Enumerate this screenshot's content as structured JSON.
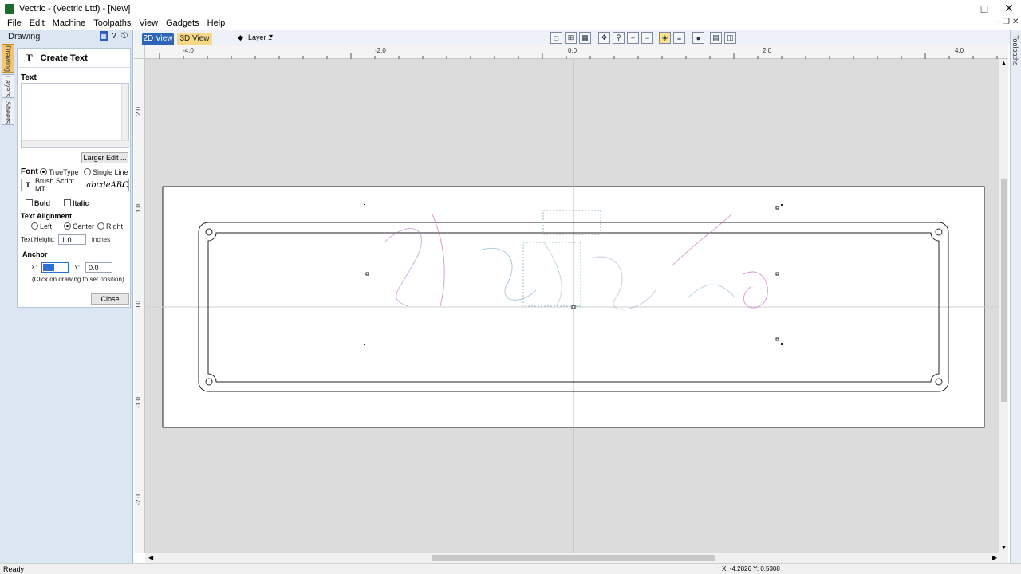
{
  "window": {
    "title": "Vectric - (Vectric Ltd) - [New]"
  },
  "menu": [
    "File",
    "Edit",
    "Machine",
    "Toolpaths",
    "View",
    "Gadgets",
    "Help"
  ],
  "panel": {
    "title": "Drawing",
    "vertical_tabs": [
      "Drawing",
      "Layers",
      "Sheets"
    ]
  },
  "form": {
    "title": "Create Text",
    "text_section": "Text",
    "text_value": "",
    "larger_edit": "Larger Edit ...",
    "font_label": "Font",
    "truetype": "TrueType",
    "single_line": "Single Line",
    "font_name": "Brush Script MT",
    "font_sample": "abcdeABC",
    "bold": "Bold",
    "italic": "Italic",
    "alignment_label": "Text Alignment",
    "align_left": "Left",
    "align_center": "Center",
    "align_right": "Right",
    "height_label": "Text Height:",
    "height_value": "1.0",
    "height_unit": "inches",
    "anchor_label": "Anchor",
    "x_label": "X:",
    "x_value": "0.0",
    "y_label": "Y:",
    "y_value": "0.0",
    "anchor_hint": "(Click on drawing to set position)",
    "close": "Close"
  },
  "view_tabs": {
    "tab_2d": "2D View",
    "tab_3d": "3D View",
    "layer": "Layer 1"
  },
  "ruler": {
    "top_ticks": [
      "-4.0",
      "-2.0",
      "0.0",
      "2.0",
      "4.0"
    ],
    "left_ticks": [
      "2.0",
      "1.0",
      "0.0",
      "-1.0",
      "-2.0"
    ]
  },
  "right_tab": "Toolpaths",
  "status": {
    "left": "Ready",
    "coords": "X: -4.2826 Y: 0.5308"
  }
}
